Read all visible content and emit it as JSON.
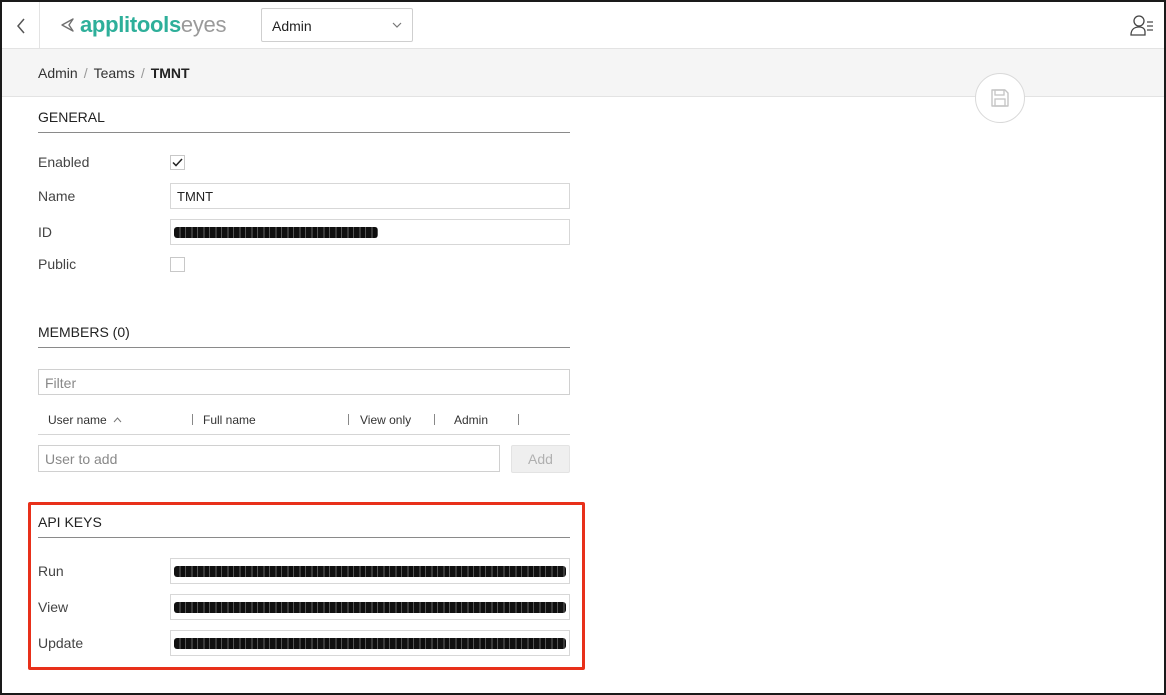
{
  "header": {
    "logo_primary": "applitools",
    "logo_secondary": "eyes",
    "logo_mark_icon": "applitools-mark-icon",
    "admin_select_value": "Admin",
    "back_icon": "chevron-left-icon",
    "user_menu_icon": "user-menu-icon"
  },
  "breadcrumb": {
    "items": [
      "Admin",
      "Teams"
    ],
    "current": "TMNT",
    "separator": "/"
  },
  "save_icon": "save-icon",
  "general": {
    "title": "GENERAL",
    "enabled_label": "Enabled",
    "enabled_checked": true,
    "name_label": "Name",
    "name_value": "TMNT",
    "id_label": "ID",
    "id_value": "[redacted]",
    "public_label": "Public",
    "public_checked": false
  },
  "members": {
    "title": "MEMBERS (0)",
    "filter_placeholder": "Filter",
    "columns": {
      "user_name": "User name",
      "full_name": "Full name",
      "view_only": "View only",
      "admin": "Admin"
    },
    "sort_icon": "sort-ascending-icon",
    "user_to_add_placeholder": "User to add",
    "add_label": "Add"
  },
  "api_keys": {
    "title": "API KEYS",
    "run_label": "Run",
    "view_label": "View",
    "update_label": "Update",
    "run_value": "[redacted]",
    "view_value": "[redacted]",
    "update_value": "[redacted]"
  },
  "colors": {
    "brand_teal": "#2eaf9a",
    "highlight_red": "#e8301a"
  }
}
